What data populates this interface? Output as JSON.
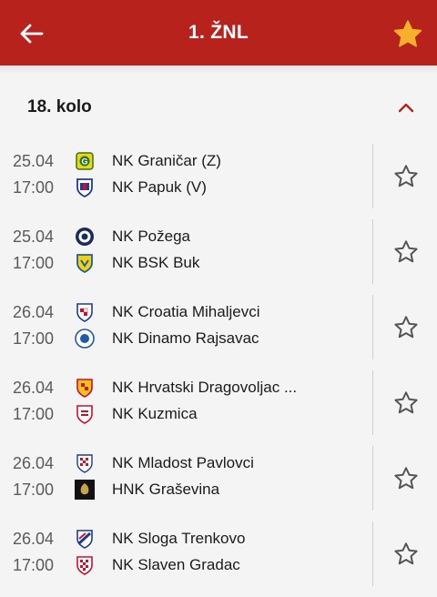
{
  "header": {
    "title": "1. ŽNL",
    "back_icon": "arrow-left-icon",
    "favorite_icon": "star-filled-icon",
    "colors": {
      "bar": "#b8221c",
      "favorite": "#f6b02b"
    }
  },
  "round": {
    "title": "18. kolo",
    "collapse_icon": "chevron-up-icon",
    "accent": "#b8221c"
  },
  "matches": [
    {
      "date": "25.04",
      "time": "17:00",
      "home": "NK Graničar (Z)",
      "away": "NK Papuk (V)"
    },
    {
      "date": "25.04",
      "time": "17:00",
      "home": "NK Požega",
      "away": "NK BSK Buk"
    },
    {
      "date": "26.04",
      "time": "17:00",
      "home": "NK Croatia Mihaljevci",
      "away": "NK Dinamo Rajsavac"
    },
    {
      "date": "26.04",
      "time": "17:00",
      "home": "NK Hrvatski Dragovoljac ...",
      "away": "NK Kuzmica"
    },
    {
      "date": "26.04",
      "time": "17:00",
      "home": "NK Mladost Pavlovci",
      "away": "HNK Graševina"
    },
    {
      "date": "26.04",
      "time": "17:00",
      "home": "NK Sloga Trenkovo",
      "away": "NK Slaven Gradac"
    }
  ]
}
